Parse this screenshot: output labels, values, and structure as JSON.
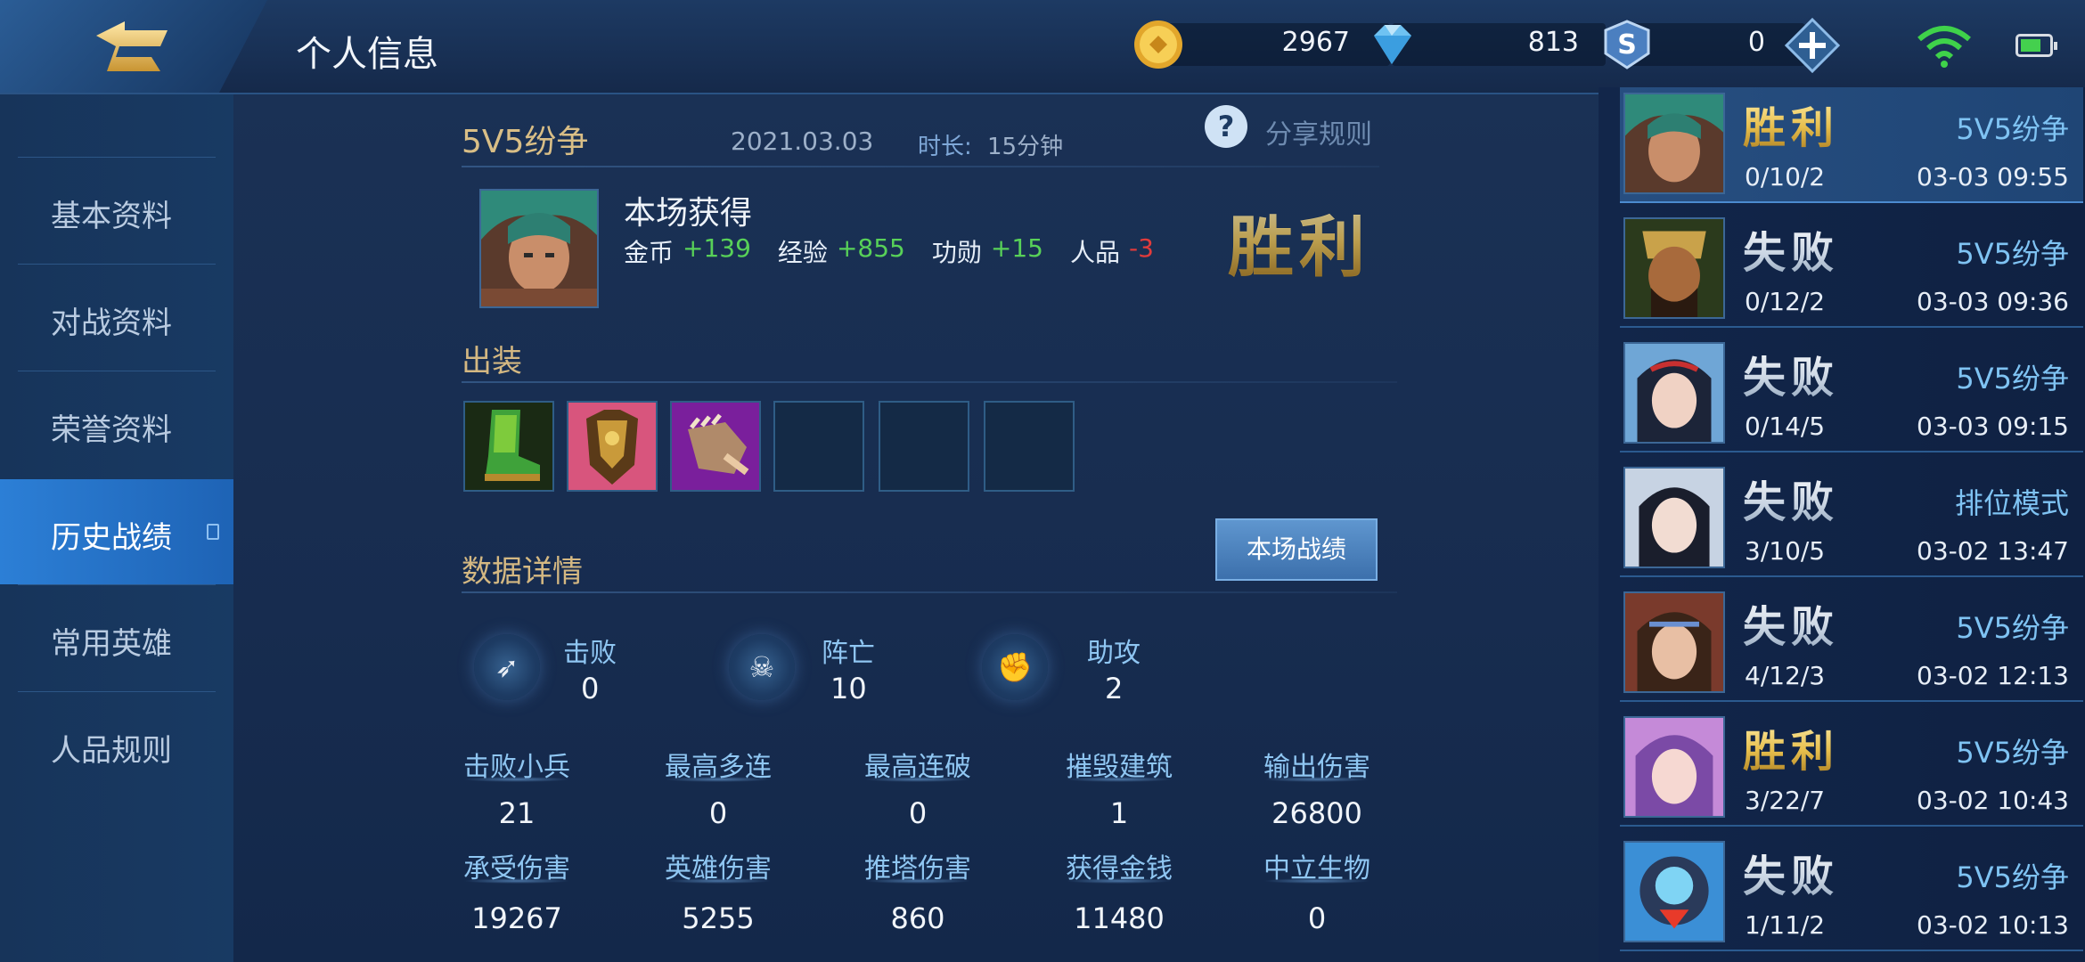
{
  "header": {
    "title": "个人信息",
    "gold": "2967",
    "diamonds": "813",
    "coupons": "0",
    "back_icon": "back-arrow-icon",
    "colors": {
      "topbar": "#1d3a63",
      "accent_blue": "#2c7fd6",
      "gold_text": "#d4b882"
    }
  },
  "sidebar": {
    "items": [
      {
        "label": "基本资料"
      },
      {
        "label": "对战资料"
      },
      {
        "label": "荣誉资料"
      },
      {
        "label": "历史战绩",
        "active": true
      },
      {
        "label": "常用英雄"
      },
      {
        "label": "人品规则"
      }
    ]
  },
  "match": {
    "mode": "5V5纷争",
    "date": "2021.03.03",
    "duration_label": "时长:",
    "duration": "15分钟",
    "share_rules": "分享规则",
    "gained_title": "本场获得",
    "rewards": [
      {
        "label": "金币",
        "value": "+139",
        "sign": "pos"
      },
      {
        "label": "经验",
        "value": "+855",
        "sign": "pos"
      },
      {
        "label": "功勋",
        "value": "+15",
        "sign": "pos"
      },
      {
        "label": "人品",
        "value": "-3",
        "sign": "neg"
      }
    ],
    "result": "胜利",
    "equipment_title": "出装",
    "equipment_slots": 6,
    "equipment_filled": [
      "boots-item",
      "armor-item",
      "gauntlet-item"
    ],
    "details_title": "数据详情",
    "details_button": "本场战绩",
    "kda": [
      {
        "label": "击败",
        "value": "0",
        "icon": "kill-icon"
      },
      {
        "label": "阵亡",
        "value": "10",
        "icon": "skull-icon"
      },
      {
        "label": "助攻",
        "value": "2",
        "icon": "assist-icon"
      }
    ],
    "stats_row1": [
      {
        "label": "击败小兵",
        "value": "21"
      },
      {
        "label": "最高多连",
        "value": "0"
      },
      {
        "label": "最高连破",
        "value": "0"
      },
      {
        "label": "摧毁建筑",
        "value": "1"
      },
      {
        "label": "输出伤害",
        "value": "26800"
      }
    ],
    "stats_row2": [
      {
        "label": "承受伤害",
        "value": "19267"
      },
      {
        "label": "英雄伤害",
        "value": "5255"
      },
      {
        "label": "推塔伤害",
        "value": "860"
      },
      {
        "label": "获得金钱",
        "value": "11480"
      },
      {
        "label": "中立生物",
        "value": "0"
      }
    ]
  },
  "history": [
    {
      "result": "胜利",
      "win": true,
      "mode": "5V5纷争",
      "kda": "0/10/2",
      "time": "03-03 09:55",
      "selected": true
    },
    {
      "result": "失败",
      "win": false,
      "mode": "5V5纷争",
      "kda": "0/12/2",
      "time": "03-03 09:36"
    },
    {
      "result": "失败",
      "win": false,
      "mode": "5V5纷争",
      "kda": "0/14/5",
      "time": "03-03 09:15"
    },
    {
      "result": "失败",
      "win": false,
      "mode": "排位模式",
      "kda": "3/10/5",
      "time": "03-02 13:47"
    },
    {
      "result": "失败",
      "win": false,
      "mode": "5V5纷争",
      "kda": "4/12/3",
      "time": "03-02 12:13"
    },
    {
      "result": "胜利",
      "win": true,
      "mode": "5V5纷争",
      "kda": "3/22/7",
      "time": "03-02 10:43"
    },
    {
      "result": "失败",
      "win": false,
      "mode": "5V5纷争",
      "kda": "1/11/2",
      "time": "03-02 10:13"
    }
  ]
}
